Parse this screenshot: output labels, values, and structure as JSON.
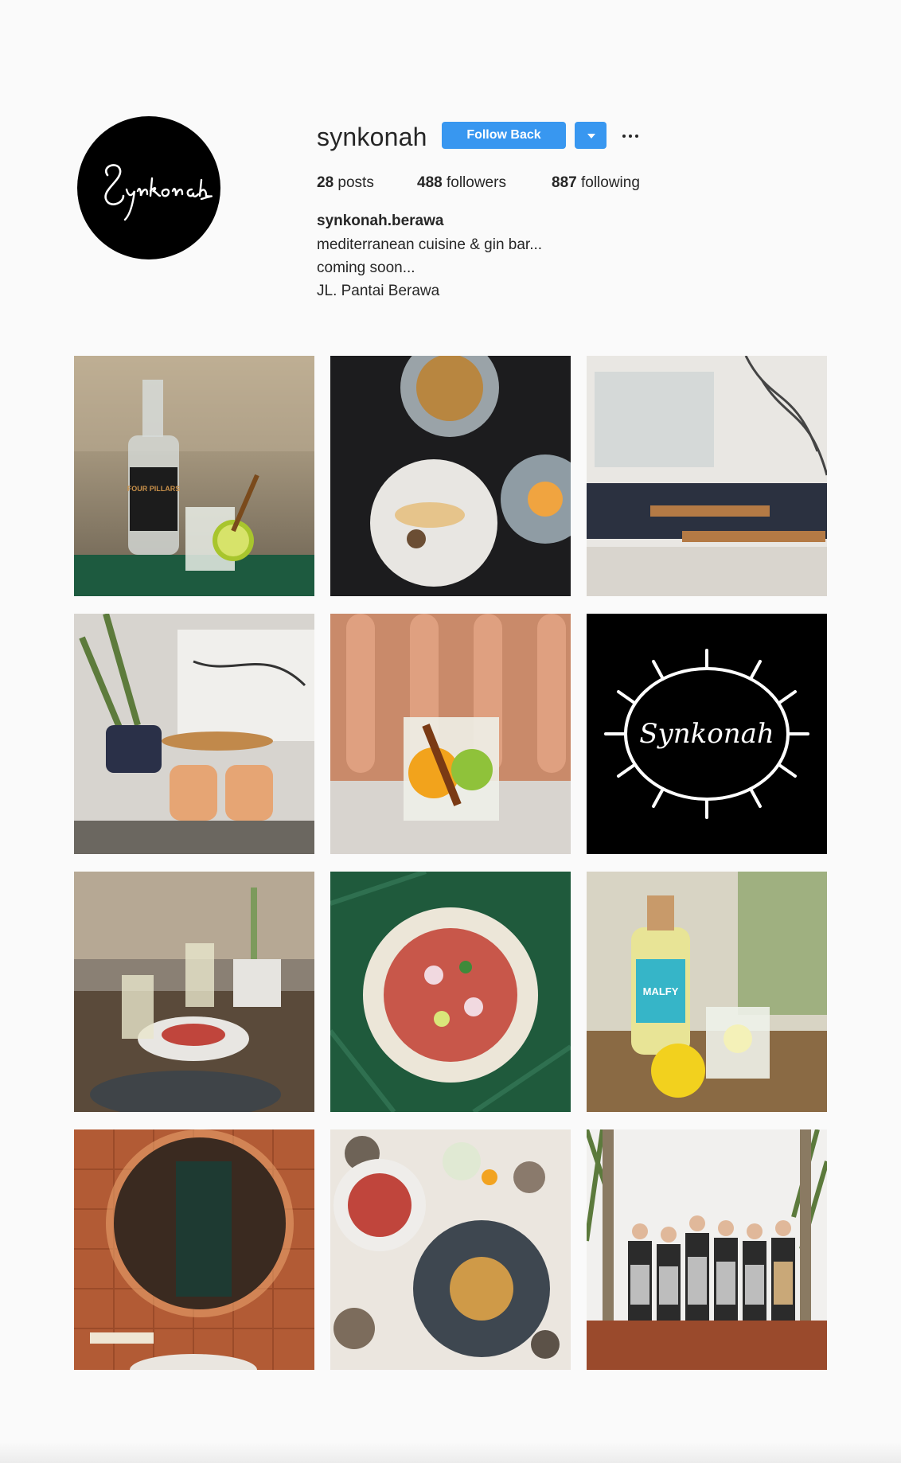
{
  "profile": {
    "avatar_text": "Synkonah",
    "username": "synkonah",
    "follow_label": "Follow Back",
    "dropdown_icon": "caret-down-icon",
    "more_icon": "more-options-icon",
    "stats": {
      "posts_count": "28",
      "posts_label": "posts",
      "followers_count": "488",
      "followers_label": "followers",
      "following_count": "887",
      "following_label": "following"
    },
    "bio_name": "synkonah.berawa",
    "bio_lines": [
      "mediterranean cuisine & gin bar...",
      "coming soon...",
      "JL. Pantai Berawa"
    ]
  },
  "posts": [
    {
      "subject": "Four Pillars gin bottle with gin and tonic",
      "label": "FOUR PILLARS"
    },
    {
      "subject": "Overhead dishes on dark wood table"
    },
    {
      "subject": "Dining area with patterned bench and tables"
    },
    {
      "subject": "Lounge with rattan chairs and leather ottomans"
    },
    {
      "subject": "Gin cocktail with cinnamon and citrus"
    },
    {
      "subject": "Synkonah sun logo on black",
      "label": "Synkonah"
    },
    {
      "subject": "Table set with wine glasses and salad"
    },
    {
      "subject": "Carpaccio plate on green marble"
    },
    {
      "subject": "Malfy gin bottle with lemon and tonic",
      "label": "MALFY"
    },
    {
      "subject": "Round mirror in terracotta tiled bathroom"
    },
    {
      "subject": "Plates on terrazzo surface"
    },
    {
      "subject": "Kitchen staff in aprons posing"
    }
  ]
}
